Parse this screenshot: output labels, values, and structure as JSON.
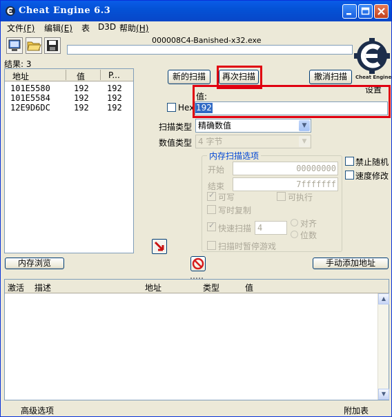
{
  "window": {
    "title": "Cheat Engine 6.3"
  },
  "menu": [
    {
      "label": "文件(F)",
      "base": "文件",
      "key": "(F)"
    },
    {
      "label": "编辑(E)",
      "base": "编辑",
      "key": "(E)"
    },
    {
      "label": "表",
      "base": "表",
      "key": ""
    },
    {
      "label": "D3D",
      "base": "D3D",
      "key": ""
    },
    {
      "label": "帮助(H)",
      "base": "帮助",
      "key": "(H)"
    }
  ],
  "toolbar": {
    "process_name": "000008C4-Banished-x32.exe",
    "logo_text": "Cheat Engine"
  },
  "results": {
    "label": "结果: 3"
  },
  "found_list": {
    "headers": [
      "地址",
      "值",
      "P..."
    ],
    "rows": [
      {
        "address": "101E5580",
        "value": "192",
        "previous": "192"
      },
      {
        "address": "101E5584",
        "value": "192",
        "previous": "192"
      },
      {
        "address": "12E9D6DC",
        "value": "192",
        "previous": "192"
      }
    ]
  },
  "scan": {
    "first_scan": "新的扫描",
    "next_scan": "再次扫描",
    "undo_scan": "撤消扫描",
    "settings": "设置",
    "value_label": "值:",
    "hex_label": "Hex",
    "value": "192",
    "scan_type_label": "扫描类型",
    "scan_type": "精确数值",
    "value_type_label": "数值类型",
    "value_type": "4 字节"
  },
  "memory_options": {
    "title": "内存扫描选项",
    "start_label": "开始",
    "start_value": "00000000",
    "stop_label": "结束",
    "stop_value": "7fffffff",
    "writable": "可写",
    "executable": "可执行",
    "copy_on_write": "写时复制",
    "fast_scan": "快速扫描",
    "fast_scan_value": "4",
    "alignment": "对齐",
    "last_digits": "位数",
    "pause_game": "扫描时暂停游戏"
  },
  "right_options": {
    "disable_random": "禁止随机",
    "speed_hack": "速度修改"
  },
  "buttons": {
    "memory_view": "内存浏览",
    "add_address": "手动添加地址"
  },
  "address_list": {
    "headers": [
      "激活",
      "描述",
      "地址",
      "类型",
      "值"
    ]
  },
  "status": {
    "advanced": "高级选项",
    "table_extras": "附加表"
  },
  "colors": {
    "titlebar": "#0054e3",
    "highlight": "#e00010",
    "selection": "#316ac5"
  }
}
